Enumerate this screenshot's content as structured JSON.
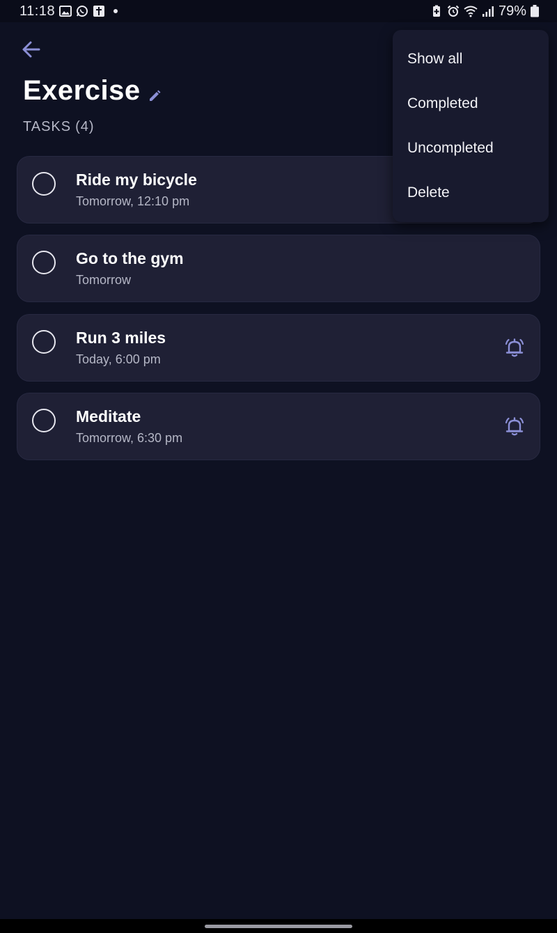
{
  "status_bar": {
    "time": "11:18",
    "battery": "79%",
    "left_icons": [
      "image-icon",
      "whatsapp-icon",
      "calendar-icon",
      "dot-icon"
    ],
    "right_icons": [
      "battery-saver-icon",
      "alarm-icon",
      "wifi-icon",
      "signal-icon",
      "battery-icon"
    ]
  },
  "header": {
    "title": "Exercise",
    "tasks_label": "TASKS",
    "tasks_count": "(4)"
  },
  "tasks": [
    {
      "title": "Ride my bicycle",
      "subtitle": "Tomorrow, 12:10 pm",
      "has_alarm": false
    },
    {
      "title": "Go to the gym",
      "subtitle": "Tomorrow",
      "has_alarm": false
    },
    {
      "title": "Run 3 miles",
      "subtitle": "Today, 6:00 pm",
      "has_alarm": true
    },
    {
      "title": "Meditate",
      "subtitle": "Tomorrow, 6:30 pm",
      "has_alarm": true
    }
  ],
  "menu": {
    "items": [
      "Show all",
      "Completed",
      "Uncompleted",
      "Delete"
    ]
  },
  "colors": {
    "background": "#0e1122",
    "card": "#1f2035",
    "accent": "#8b8fd6",
    "menu": "#181a2e"
  }
}
